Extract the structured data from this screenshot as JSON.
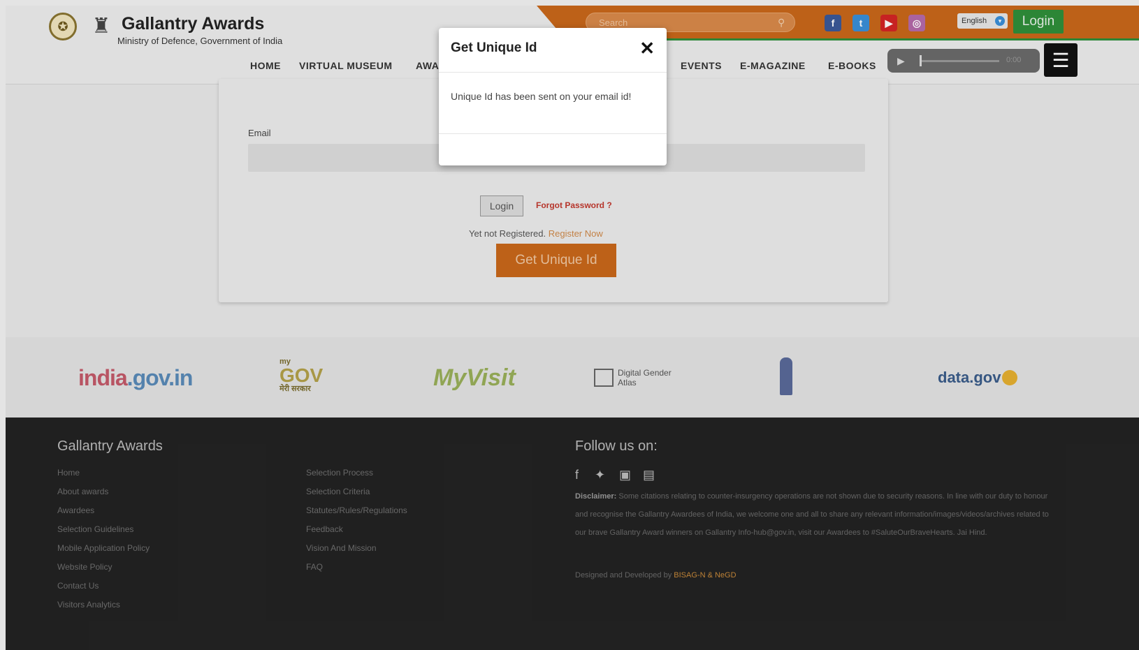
{
  "header": {
    "brand_title": "Gallantry Awards",
    "brand_subtitle": "Ministry of Defence, Government of India",
    "search_placeholder": "Search",
    "language": "English",
    "login_label": "Login",
    "nav": [
      "HOME",
      "VIRTUAL MUSEUM",
      "AWA",
      "EVENTS",
      "E-MAGAZINE",
      "E-BOOKS"
    ],
    "player_time": "0:00"
  },
  "form": {
    "email_label": "Email",
    "login_button": "Login",
    "forgot_password": "Forgot Password ?",
    "not_registered": "Yet not Registered.",
    "register_now": "Register Now",
    "unique_id_button": "Get Unique Id"
  },
  "logos": {
    "india_a": "india",
    "india_b": ".gov.in",
    "mygov_top": "my",
    "mygov_main": "GOV",
    "mygov_sub": "मेरी सरकार",
    "myvisit": "MyVisit",
    "gender_atlas": "Digital Gender Atlas",
    "datagov": "data.gov"
  },
  "footer": {
    "title": "Gallantry Awards",
    "col1": [
      "Home",
      "About awards",
      "Awardees",
      "Selection Guidelines",
      "Mobile Application Policy",
      "Website Policy",
      "Contact Us",
      "Visitors Analytics"
    ],
    "col2": [
      "Selection Process",
      "Selection Criteria",
      "Statutes/Rules/Regulations",
      "Feedback",
      "Vision And Mission",
      "FAQ"
    ],
    "follow_title": "Follow us on:",
    "disclaimer_label": "Disclaimer:",
    "disclaimer_text": "Some citations relating to counter-insurgency operations are not shown due to security reasons. In line with our duty to honour and recognise the Gallantry Awardees of India, we welcome one and all to share any relevant information/images/videos/archives related to our brave Gallantry Award winners on Gallantry Info-hub@gov.in, visit our Awardees to #SaluteOurBraveHearts. Jai Hind.",
    "designed_by": "Designed and Developed by",
    "developer": "BISAG-N & NeGD"
  },
  "modal": {
    "title": "Get Unique Id",
    "close": "✕",
    "message": "Unique Id has been sent on your email id!"
  }
}
